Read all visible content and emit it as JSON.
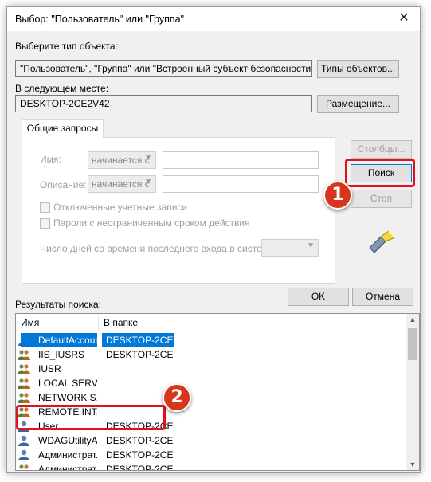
{
  "window": {
    "title": "Выбор: \"Пользователь\" или \"Группа\""
  },
  "object_type": {
    "label": "Выберите тип объекта:",
    "value": "\"Пользователь\", \"Группа\" или \"Встроенный субъект безопасности\"",
    "button": "Типы объектов..."
  },
  "location": {
    "label": "В следующем месте:",
    "value": "DESKTOP-2CE2V42",
    "button": "Размещение..."
  },
  "queries_tab": {
    "label": "Общие запросы",
    "name_label": "Имя:",
    "name_combo": "начинается с",
    "desc_label": "Описание:",
    "desc_combo": "начинается с",
    "disabled_accounts": "Отключенные учетные записи",
    "nonexpiring_passwords": "Пароли с неограниченным сроком действия",
    "days_label": "Число дней со времени последнего входа в систему:"
  },
  "side_buttons": {
    "columns": "Столбцы...",
    "search": "Поиск",
    "stop": "Стоп"
  },
  "dialog_buttons": {
    "ok": "OK",
    "cancel": "Отмена"
  },
  "results": {
    "label": "Результаты поиска:",
    "headers": [
      "Имя",
      "В папке"
    ],
    "rows": [
      {
        "name": "DefaultAccount",
        "folder": "DESKTOP-2CE..."
      },
      {
        "name": "IIS_IUSRS",
        "folder": "DESKTOP-2CE..."
      },
      {
        "name": "IUSR",
        "folder": ""
      },
      {
        "name": "LOCAL SERV...",
        "folder": ""
      },
      {
        "name": "NETWORK S...",
        "folder": ""
      },
      {
        "name": "REMOTE INT...",
        "folder": ""
      },
      {
        "name": "User",
        "folder": "DESKTOP-2CE..."
      },
      {
        "name": "WDAGUtilityA...",
        "folder": "DESKTOP-2CE..."
      },
      {
        "name": "Администрат...",
        "folder": "DESKTOP-2CE..."
      },
      {
        "name": "Администрат...",
        "folder": "DESKTOP-2CE..."
      }
    ]
  },
  "callouts": {
    "step1": "1",
    "step2": "2"
  },
  "colors": {
    "highlight": "#e0101c",
    "badge": "#d7351c",
    "selection": "#0078d7"
  },
  "icons": [
    "close-icon",
    "search-flashlight-icon",
    "user-icon",
    "group-icon",
    "scroll-up-icon",
    "scroll-down-icon",
    "chevron-down-icon"
  ]
}
